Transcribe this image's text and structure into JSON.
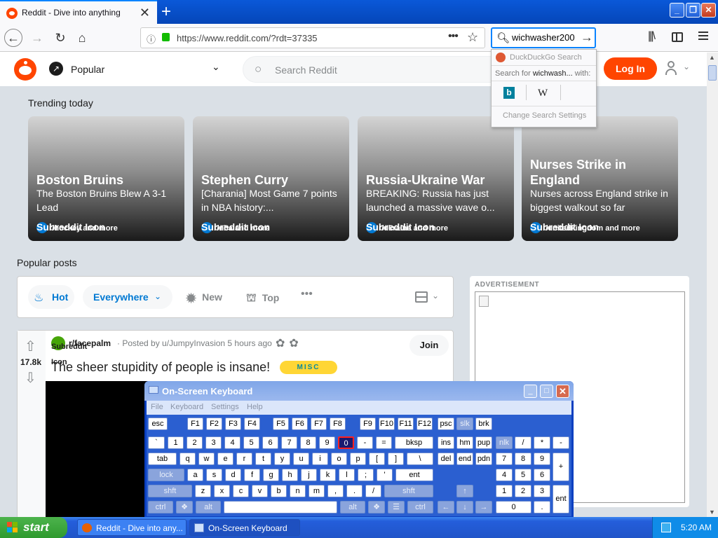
{
  "browser": {
    "tab_title": "Reddit - Dive into anything",
    "url": "https://www.reddit.com/?rdt=37335",
    "search_value": "wichwasher200",
    "search_dropdown": {
      "engine_label": "DuckDuckGo Search",
      "search_for_prefix": "Search for",
      "search_for_term": "wichwash...",
      "search_for_suffix": "with:",
      "bing_glyph": "b",
      "wiki_glyph": "W",
      "change_settings": "Change Search Settings"
    }
  },
  "reddit": {
    "nav_label": "Popular",
    "search_placeholder": "Search Reddit",
    "login_label": "Log In",
    "trending_title": "Trending today",
    "trending": [
      {
        "title": "Boston Bruins",
        "subtitle": "The Boston Bruins Blew A 3-1 Lead",
        "sub_label": "Subreddit Icon",
        "more": "r/hockey and more"
      },
      {
        "title": "Stephen Curry",
        "subtitle": "[Charania] Most Game 7 points in NBA history:...",
        "sub_label": "Subreddit Icon",
        "more": "r/nba and more"
      },
      {
        "title": "Russia-Ukraine War",
        "subtitle": "BREAKING: Russia has just launched a massive wave o...",
        "sub_label": "Subreddit Icon",
        "more": "r/ukraine and more"
      },
      {
        "title": "Nurses Strike in England",
        "subtitle": "Nurses across England strike in biggest walkout so far",
        "sub_label": "Subreddit Icon",
        "more": "r/unitedkingdom and more"
      }
    ],
    "popular_title": "Popular posts",
    "sort": {
      "hot": "Hot",
      "everywhere": "Everywhere",
      "new": "New",
      "top": "Top"
    },
    "post": {
      "votes": "17.8k",
      "subreddit_icon_alt": "Subreddit Icon",
      "subreddit": "r/facepalm",
      "posted_by": "· Posted by u/JumpyInvasion 5 hours ago",
      "join_label": "Join",
      "title": "The sheer stupidity of people is insane!",
      "flair": "MISC"
    },
    "ad_label": "ADVERTISEMENT"
  },
  "osk": {
    "title": "On-Screen Keyboard",
    "menu": [
      "File",
      "Keyboard",
      "Settings",
      "Help"
    ]
  },
  "taskbar": {
    "start_label": "start",
    "task1": "Reddit - Dive into any...",
    "task2": "On-Screen Keyboard",
    "clock": "5:20 AM"
  },
  "colors": {
    "reddit_orange": "#ff4500",
    "reddit_blue": "#0079d3",
    "xp_blue": "#245edb",
    "start_green": "#2f9a2f"
  }
}
